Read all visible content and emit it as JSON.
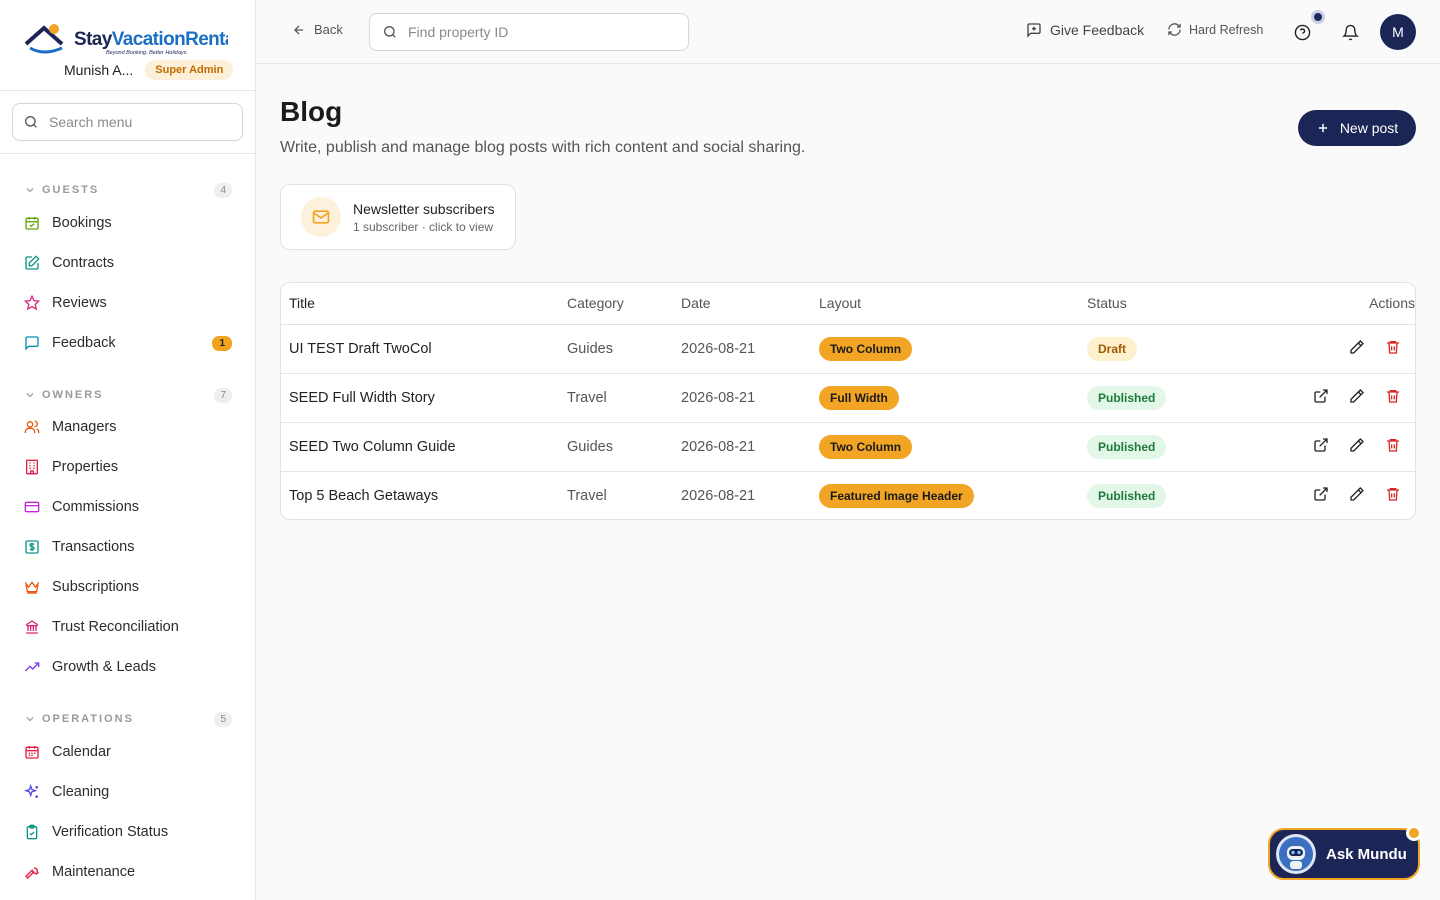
{
  "brand": {
    "name_part1": "Stay",
    "name_part2": "VacationRentals",
    "tagline": "Beyond Booking. Better Holidays."
  },
  "user": {
    "name": "Munish A...",
    "role": "Super Admin",
    "avatar_initial": "M"
  },
  "sidebar": {
    "search_placeholder": "Search menu",
    "sections": [
      {
        "title": "GUESTS",
        "count": "4",
        "items": [
          {
            "label": "Bookings",
            "icon": "calendar-check-icon",
            "color": "#65a30d"
          },
          {
            "label": "Contracts",
            "icon": "edit-doc-icon",
            "color": "#0d9488"
          },
          {
            "label": "Reviews",
            "icon": "star-icon",
            "color": "#db2777"
          },
          {
            "label": "Feedback",
            "icon": "message-square-icon",
            "color": "#0891b2",
            "badge": "1"
          }
        ]
      },
      {
        "title": "OWNERS",
        "count": "7",
        "items": [
          {
            "label": "Managers",
            "icon": "users-icon",
            "color": "#ea580c"
          },
          {
            "label": "Properties",
            "icon": "building-icon",
            "color": "#e11d48"
          },
          {
            "label": "Commissions",
            "icon": "credit-card-icon",
            "color": "#c026d3"
          },
          {
            "label": "Transactions",
            "icon": "dollar-receipt-icon",
            "color": "#0d9488"
          },
          {
            "label": "Subscriptions",
            "icon": "crown-icon",
            "color": "#ea580c"
          },
          {
            "label": "Trust Reconciliation",
            "icon": "bank-icon",
            "color": "#db2777"
          },
          {
            "label": "Growth & Leads",
            "icon": "trending-up-icon",
            "color": "#7c3aed"
          }
        ]
      },
      {
        "title": "OPERATIONS",
        "count": "5",
        "items": [
          {
            "label": "Calendar",
            "icon": "calendar-icon",
            "color": "#e11d48"
          },
          {
            "label": "Cleaning",
            "icon": "sparkles-icon",
            "color": "#4f46e5"
          },
          {
            "label": "Verification Status",
            "icon": "clipboard-check-icon",
            "color": "#0d9488"
          },
          {
            "label": "Maintenance",
            "icon": "wrench-icon",
            "color": "#e11d48"
          }
        ]
      }
    ]
  },
  "topbar": {
    "back_label": "Back",
    "search_placeholder": "Find property ID",
    "feedback_label": "Give Feedback",
    "refresh_label": "Hard Refresh"
  },
  "page": {
    "title": "Blog",
    "subtitle": "Write, publish and manage blog posts with rich content and social sharing.",
    "new_post_label": "New post"
  },
  "subscribers_card": {
    "title": "Newsletter subscribers",
    "meta": "1 subscriber · click to view"
  },
  "table": {
    "headers": {
      "title": "Title",
      "category": "Category",
      "date": "Date",
      "layout": "Layout",
      "status": "Status",
      "actions": "Actions"
    },
    "rows": [
      {
        "title": "UI TEST Draft TwoCol",
        "category": "Guides",
        "date": "2026-08-21",
        "layout": "Two Column",
        "status": "Draft",
        "has_view": false
      },
      {
        "title": "SEED Full Width Story",
        "category": "Travel",
        "date": "2026-08-21",
        "layout": "Full Width",
        "status": "Published",
        "has_view": true
      },
      {
        "title": "SEED Two Column Guide",
        "category": "Guides",
        "date": "2026-08-21",
        "layout": "Two Column",
        "status": "Published",
        "has_view": true
      },
      {
        "title": "Top 5 Beach Getaways",
        "category": "Travel",
        "date": "2026-08-21",
        "layout": "Featured Image Header",
        "status": "Published",
        "has_view": true
      }
    ]
  },
  "assistant": {
    "label": "Ask Mundu"
  },
  "colors": {
    "primary": "#1b2656",
    "accent": "#f2a524",
    "danger": "#dc2626"
  }
}
